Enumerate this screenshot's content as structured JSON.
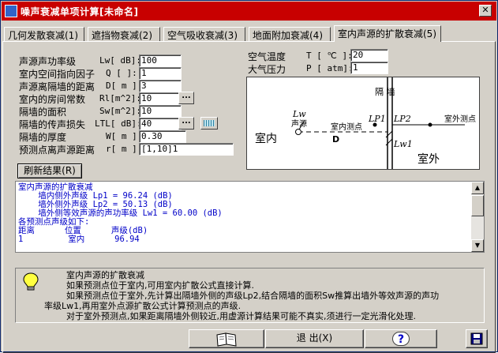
{
  "window": {
    "title": "噪声衰减单项计算[未命名]",
    "close_glyph": "✕"
  },
  "tabs": [
    {
      "label": "几何发散衰减(1)"
    },
    {
      "label": "遮挡物衰减(2)"
    },
    {
      "label": "空气吸收衰减(3)"
    },
    {
      "label": "地面附加衰减(4)"
    },
    {
      "label": "室内声源的扩散衰减(5)",
      "active": true
    }
  ],
  "form": [
    {
      "label": "声源声功率级",
      "symbol": "Lw[ dB]:",
      "value": "100"
    },
    {
      "label": "室内空间指向因子",
      "symbol": "Q [ ]:",
      "value": "1"
    },
    {
      "label": "声源离隔墙的距离",
      "symbol": "D[ m ]:",
      "value": "3"
    },
    {
      "label": "室内的房间常数",
      "symbol": "Rl[m^2]:",
      "value": "10",
      "has_dots": true
    },
    {
      "label": "隔墙的面积",
      "symbol": "Sw[m^2]:",
      "value": "10"
    },
    {
      "label": "隔墙的传声损失",
      "symbol": "LTL[ dB]:",
      "value": "40",
      "has_dots": true,
      "has_grid": true
    },
    {
      "label": "隔墙的厚度",
      "symbol": "W[ m ]:",
      "value": "0.30"
    },
    {
      "label": "预测点离声源距离",
      "symbol": "r[ m ]:",
      "value": "[1,10]1"
    }
  ],
  "air": [
    {
      "label": "空气温度",
      "symbol": "T [ ℃ ]:",
      "value": "20"
    },
    {
      "label": "大气压力",
      "symbol": "P [ atm]:",
      "value": "1"
    }
  ],
  "diagram": {
    "wall_label": "隔  墙",
    "indoor": "室内",
    "outdoor": "室外",
    "source_symbol": "Lw",
    "source_label": "声源",
    "indoor_point": "室内测点",
    "outdoor_point": "室外测点",
    "lp1": "LP1",
    "lp2": "LP2",
    "lw1": "Lw1",
    "d_label": "D"
  },
  "refresh_button": "刷新结果(R)",
  "result_lines": [
    "室内声源的扩散衰减",
    "    墙内侧外声级 Lp1 = 96.24 (dB)",
    "    墙外侧外声级 Lp2 = 50.13 (dB)",
    "    墙外侧等效声源的声功率级 Lw1 = 60.00 (dB)",
    "各预测点声级如下:",
    "距离      位置      声级(dB)",
    "1         室内      96.94"
  ],
  "help_lines": [
    "室内声源的扩散衰减",
    "如果预测点位于室内,可用室内扩散公式直接计算.",
    "如果预测点位于室外,先计算出隔墙外侧的声级Lp2,结合隔墙的面积Sw推算出墙外等效声源的声功",
    "率级Lw1,再用室外点源扩散公式计算预测点的声级.",
    "对于室外预测点,如果距离隔墙外侧较近,用虚源计算结果可能不真实,须进行一定光滑化处理."
  ],
  "buttons": {
    "exit": "退 出(X)",
    "help_glyph": "?"
  },
  "colors": {
    "title_bar": "#c80000",
    "result_text": "#0000c8",
    "face": "#d4d0c8"
  }
}
